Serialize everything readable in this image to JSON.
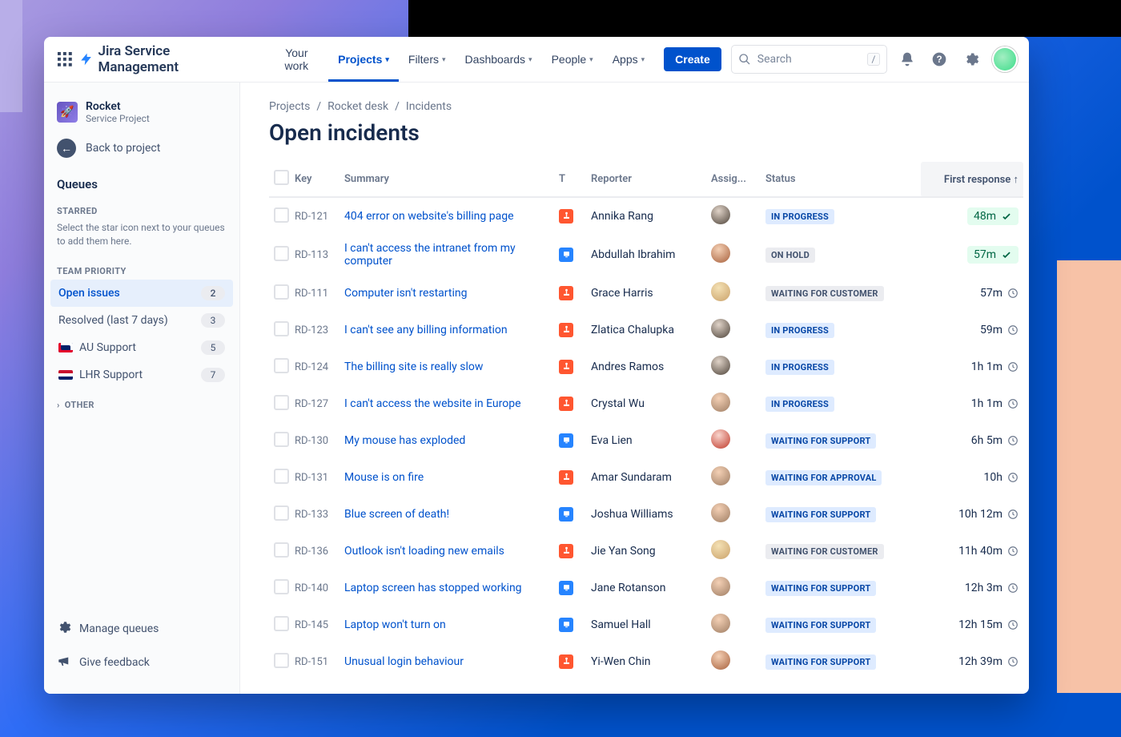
{
  "topnav": {
    "product": "Jira Service Management",
    "items": [
      {
        "label": "Your work",
        "dropdown": false
      },
      {
        "label": "Projects",
        "dropdown": true
      },
      {
        "label": "Filters",
        "dropdown": true
      },
      {
        "label": "Dashboards",
        "dropdown": true
      },
      {
        "label": "People",
        "dropdown": true
      },
      {
        "label": "Apps",
        "dropdown": true
      }
    ],
    "active_index": 1,
    "create": "Create",
    "search_placeholder": "Search",
    "search_kbd": "/"
  },
  "sidebar": {
    "project": {
      "name": "Rocket",
      "type": "Service Project"
    },
    "back": "Back to project",
    "queues_title": "Queues",
    "starred_title": "STARRED",
    "starred_hint": "Select the star icon next to your queues to add them here.",
    "team_title": "TEAM PRIORITY",
    "team_items": [
      {
        "label": "Open issues",
        "count": "2",
        "flag": ""
      },
      {
        "label": "Resolved (last 7 days)",
        "count": "3",
        "flag": ""
      },
      {
        "label": "AU Support",
        "count": "5",
        "flag": "au"
      },
      {
        "label": "LHR Support",
        "count": "7",
        "flag": "uk"
      }
    ],
    "active_team_index": 0,
    "other_title": "OTHER",
    "manage": "Manage queues",
    "feedback": "Give feedback"
  },
  "main": {
    "crumbs": [
      "Projects",
      "Rocket desk",
      "Incidents"
    ],
    "title": "Open incidents",
    "columns": [
      "Key",
      "Summary",
      "T",
      "Reporter",
      "Assig...",
      "Status",
      "First response"
    ],
    "sort_col": 6,
    "sort_dir": "asc",
    "rows": [
      {
        "key": "RD-121",
        "summary": "404 error on website's billing page",
        "t": "orange",
        "reporter": "Annika Rang",
        "assigAv": "av-c3",
        "status": "IN PROGRESS",
        "statusClass": "inprogress",
        "resp": "48m",
        "met": true
      },
      {
        "key": "RD-113",
        "summary": "I can't access the intranet from my computer",
        "t": "blue",
        "reporter": "Abdullah Ibrahim",
        "assigAv": "av-c1",
        "status": "ON HOLD",
        "statusClass": "onhold",
        "resp": "57m",
        "met": true
      },
      {
        "key": "RD-111",
        "summary": "Computer isn't restarting",
        "t": "orange",
        "reporter": "Grace Harris",
        "assigAv": "av-c2",
        "status": "WAITING FOR CUSTOMER",
        "statusClass": "waitingcust",
        "resp": "57m",
        "met": false
      },
      {
        "key": "RD-123",
        "summary": "I can't see any billing information",
        "t": "orange",
        "reporter": "Zlatica Chalupka",
        "assigAv": "av-c3",
        "status": "IN PROGRESS",
        "statusClass": "inprogress",
        "resp": "59m",
        "met": false
      },
      {
        "key": "RD-124",
        "summary": "The billing site is really slow",
        "t": "orange",
        "reporter": "Andres Ramos",
        "assigAv": "av-c3",
        "status": "IN PROGRESS",
        "statusClass": "inprogress",
        "resp": "1h 1m",
        "met": false
      },
      {
        "key": "RD-127",
        "summary": "I can't access the website in Europe",
        "t": "orange",
        "reporter": "Crystal Wu",
        "assigAv": "av-c0",
        "status": "IN PROGRESS",
        "statusClass": "inprogress",
        "resp": "1h 1m",
        "met": false
      },
      {
        "key": "RD-130",
        "summary": "My mouse has exploded",
        "t": "blue",
        "reporter": "Eva Lien",
        "assigAv": "av-c4",
        "status": "WAITING FOR SUPPORT",
        "statusClass": "waitingsupport",
        "resp": "6h 5m",
        "met": false
      },
      {
        "key": "RD-131",
        "summary": "Mouse is on fire",
        "t": "orange",
        "reporter": "Amar Sundaram",
        "assigAv": "av-c0",
        "status": "WAITING FOR APPROVAL",
        "statusClass": "waitingapproval",
        "resp": "10h",
        "met": false
      },
      {
        "key": "RD-133",
        "summary": "Blue screen of death!",
        "t": "blue",
        "reporter": "Joshua Williams",
        "assigAv": "av-c0",
        "status": "WAITING FOR SUPPORT",
        "statusClass": "waitingsupport",
        "resp": "10h 12m",
        "met": false
      },
      {
        "key": "RD-136",
        "summary": "Outlook isn't loading new emails",
        "t": "orange",
        "reporter": "Jie Yan Song",
        "assigAv": "av-c2",
        "status": "WAITING FOR CUSTOMER",
        "statusClass": "waitingcust",
        "resp": "11h 40m",
        "met": false
      },
      {
        "key": "RD-140",
        "summary": "Laptop screen has stopped working",
        "t": "blue",
        "reporter": "Jane Rotanson",
        "assigAv": "av-c0",
        "status": "WAITING FOR SUPPORT",
        "statusClass": "waitingsupport",
        "resp": "12h 3m",
        "met": false
      },
      {
        "key": "RD-145",
        "summary": "Laptop won't turn on",
        "t": "blue",
        "reporter": "Samuel Hall",
        "assigAv": "av-c0",
        "status": "WAITING FOR SUPPORT",
        "statusClass": "waitingsupport",
        "resp": "12h 15m",
        "met": false
      },
      {
        "key": "RD-151",
        "summary": "Unusual login behaviour",
        "t": "orange",
        "reporter": "Yi-Wen Chin",
        "assigAv": "av-c1",
        "status": "WAITING FOR SUPPORT",
        "statusClass": "waitingsupport",
        "resp": "12h 39m",
        "met": false
      }
    ]
  }
}
